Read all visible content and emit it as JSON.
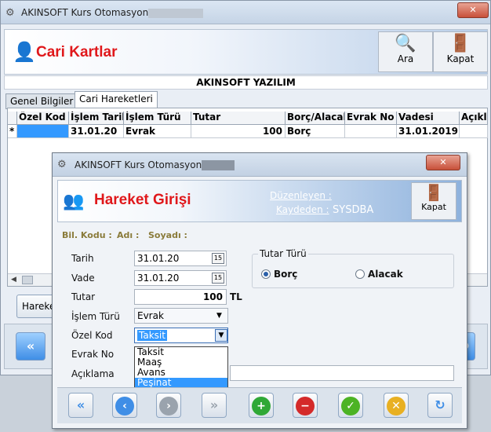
{
  "main": {
    "title": "AKINSOFT Kurs Otomasyonu s",
    "header_title": "Cari Kartlar",
    "search_label": "Ara",
    "close_label": "Kapat",
    "company": "AKINSOFT YAZILIM",
    "tabs": [
      "Genel Bilgiler",
      "Cari Hareketleri"
    ],
    "columns": [
      "Özel Kod",
      "İşlem Tarihi",
      "İşlem Türü",
      "Tutar",
      "Borç/Alacak",
      "Evrak No",
      "Vadesi",
      "Açıkla"
    ],
    "row": {
      "marker": "*",
      "ozel_kod": "",
      "islem_tarihi": "31.01.20",
      "islem_turu": "Evrak",
      "tutar": "100",
      "borc_alacak": "Borç",
      "evrak_no": "",
      "vadesi": "31.01.2019",
      "aciklama": ""
    },
    "bottom_button": "Hareke"
  },
  "dialog": {
    "title": "AKINSOFT Kurs Otomasyonu s",
    "header_title": "Hareket Girişi",
    "duzenleyen_label": "Düzenleyen :",
    "kaydeden_label": "Kaydeden :",
    "kaydeden_value": "SYSDBA",
    "close_label": "Kapat",
    "bil_kodu_label": "Bil. Kodu :",
    "adi_label": "Adı :",
    "soyadi_label": "Soyadı :",
    "tarih_label": "Tarih",
    "tarih_value": "31.01.20",
    "vade_label": "Vade",
    "vade_value": "31.01.20",
    "tutar_label": "Tutar",
    "tutar_value": "100",
    "currency": "TL",
    "islem_turu_label": "İşlem Türü",
    "islem_turu_value": "Evrak",
    "ozel_kod_label": "Özel Kod",
    "ozel_kod_value": "Taksit",
    "evrak_no_label": "Evrak No",
    "aciklama_label": "Açıklama",
    "tutar_turu_label": "Tutar Türü",
    "borc_label": "Borç",
    "alacak_label": "Alacak",
    "selected_tutar_turu": "Borç",
    "dropdown_options": [
      "Taksit",
      "Maaş",
      "Avans",
      "Peşinat"
    ],
    "dropdown_highlighted": "Peşinat"
  },
  "colors": {
    "header_title": "#e0181b",
    "info_label": "#8a7b3a",
    "selection": "#3399ff",
    "add": "#2fa836",
    "delete": "#d42a2a",
    "confirm": "#4cb324",
    "cancel": "#e8b022",
    "nav_blue": "#3f8ee6"
  },
  "icons": {
    "header": "user-card-icon",
    "search": "magnifier-icon",
    "close": "door-exit-icon",
    "calendar": "calendar-icon"
  }
}
